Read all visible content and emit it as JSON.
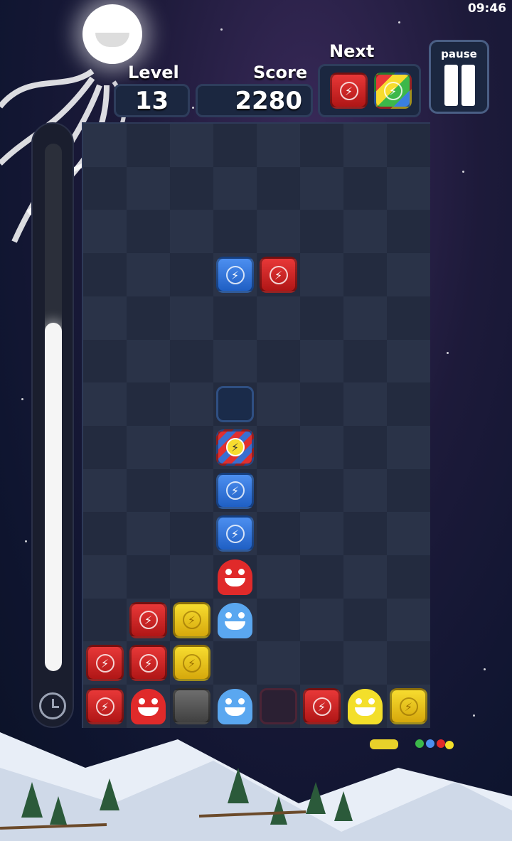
{
  "status_bar": {
    "time": "09:46"
  },
  "hud": {
    "level_label": "Level",
    "level_value": "13",
    "score_label": "Score",
    "score_value": "2280",
    "next_label": "Next",
    "next_pieces": [
      "red-gem",
      "rainbow-gem"
    ]
  },
  "pause": {
    "label": "pause"
  },
  "timer_meter": {
    "fill_fraction": 0.66
  },
  "board": {
    "columns": 8,
    "rows": 14,
    "pieces": [
      {
        "row": 3,
        "col": 3,
        "kind": "blue-gem"
      },
      {
        "row": 3,
        "col": 4,
        "kind": "red-gem"
      },
      {
        "row": 6,
        "col": 3,
        "kind": "drop-target"
      },
      {
        "row": 7,
        "col": 3,
        "kind": "striped-gem"
      },
      {
        "row": 8,
        "col": 3,
        "kind": "blue-gem"
      },
      {
        "row": 9,
        "col": 3,
        "kind": "blue-gem"
      },
      {
        "row": 10,
        "col": 3,
        "kind": "red-monster"
      },
      {
        "row": 11,
        "col": 1,
        "kind": "red-gem"
      },
      {
        "row": 11,
        "col": 2,
        "kind": "yellow-gem"
      },
      {
        "row": 11,
        "col": 3,
        "kind": "blue-monster"
      },
      {
        "row": 12,
        "col": 0,
        "kind": "red-gem"
      },
      {
        "row": 12,
        "col": 1,
        "kind": "red-gem"
      },
      {
        "row": 12,
        "col": 2,
        "kind": "yellow-gem"
      },
      {
        "row": 13,
        "col": 0,
        "kind": "red-gem"
      },
      {
        "row": 13,
        "col": 1,
        "kind": "red-monster"
      },
      {
        "row": 13,
        "col": 2,
        "kind": "stone-block"
      },
      {
        "row": 13,
        "col": 3,
        "kind": "blue-monster"
      },
      {
        "row": 13,
        "col": 4,
        "kind": "red-ghost-target"
      },
      {
        "row": 13,
        "col": 5,
        "kind": "red-gem"
      },
      {
        "row": 13,
        "col": 6,
        "kind": "yellow-monster"
      },
      {
        "row": 13,
        "col": 7,
        "kind": "yellow-gem"
      }
    ]
  },
  "icons": {
    "bolt": "lightning-bolt-icon",
    "timer": "stopwatch-icon",
    "pause": "pause-icon"
  },
  "colors": {
    "red": "#e02a2a",
    "blue": "#4d8ff0",
    "yellow": "#f3df2a",
    "hud_bg": "#1b2740"
  }
}
